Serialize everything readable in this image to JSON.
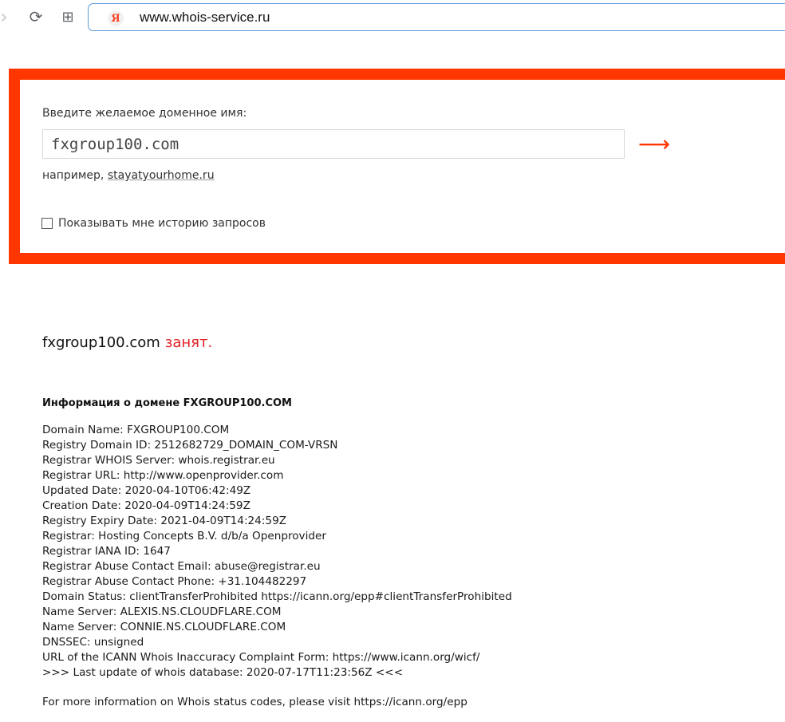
{
  "browser": {
    "url": "www.whois-service.ru",
    "logo_letter": "Я",
    "back_glyph": "›",
    "reload_glyph": "⟳",
    "tabs_glyph": "⊞"
  },
  "search": {
    "label": "Введите желаемое доменное имя:",
    "input_value": "fxgroup100.com",
    "submit_glyph": "⟶",
    "example_prefix": "например, ",
    "example_link": "stayatyourhome.ru",
    "history_label": "Показывать мне историю запросов",
    "history_checked": false,
    "accent_color": "#ff3600"
  },
  "result": {
    "domain": "fxgroup100.com",
    "status": "занят.",
    "status_color": "#e31e24",
    "info_heading": "Информация о домене FXGROUP100.COM",
    "whois_lines": [
      "Domain Name: FXGROUP100.COM",
      "Registry Domain ID: 2512682729_DOMAIN_COM-VRSN",
      "Registrar WHOIS Server: whois.registrar.eu",
      "Registrar URL: http://www.openprovider.com",
      "Updated Date: 2020-04-10T06:42:49Z",
      "Creation Date: 2020-04-09T14:24:59Z",
      "Registry Expiry Date: 2021-04-09T14:24:59Z",
      "Registrar: Hosting Concepts B.V. d/b/a Openprovider",
      "Registrar IANA ID: 1647",
      "Registrar Abuse Contact Email: abuse@registrar.eu",
      "Registrar Abuse Contact Phone: +31.104482297",
      "Domain Status: clientTransferProhibited https://icann.org/epp#clientTransferProhibited",
      "Name Server: ALEXIS.NS.CLOUDFLARE.COM",
      "Name Server: CONNIE.NS.CLOUDFLARE.COM",
      "DNSSEC: unsigned",
      "URL of the ICANN Whois Inaccuracy Complaint Form: https://www.icann.org/wicf/",
      ">>> Last update of whois database: 2020-07-17T11:23:56Z <<<"
    ],
    "footer_note": "For more information on Whois status codes, please visit https://icann.org/epp"
  }
}
